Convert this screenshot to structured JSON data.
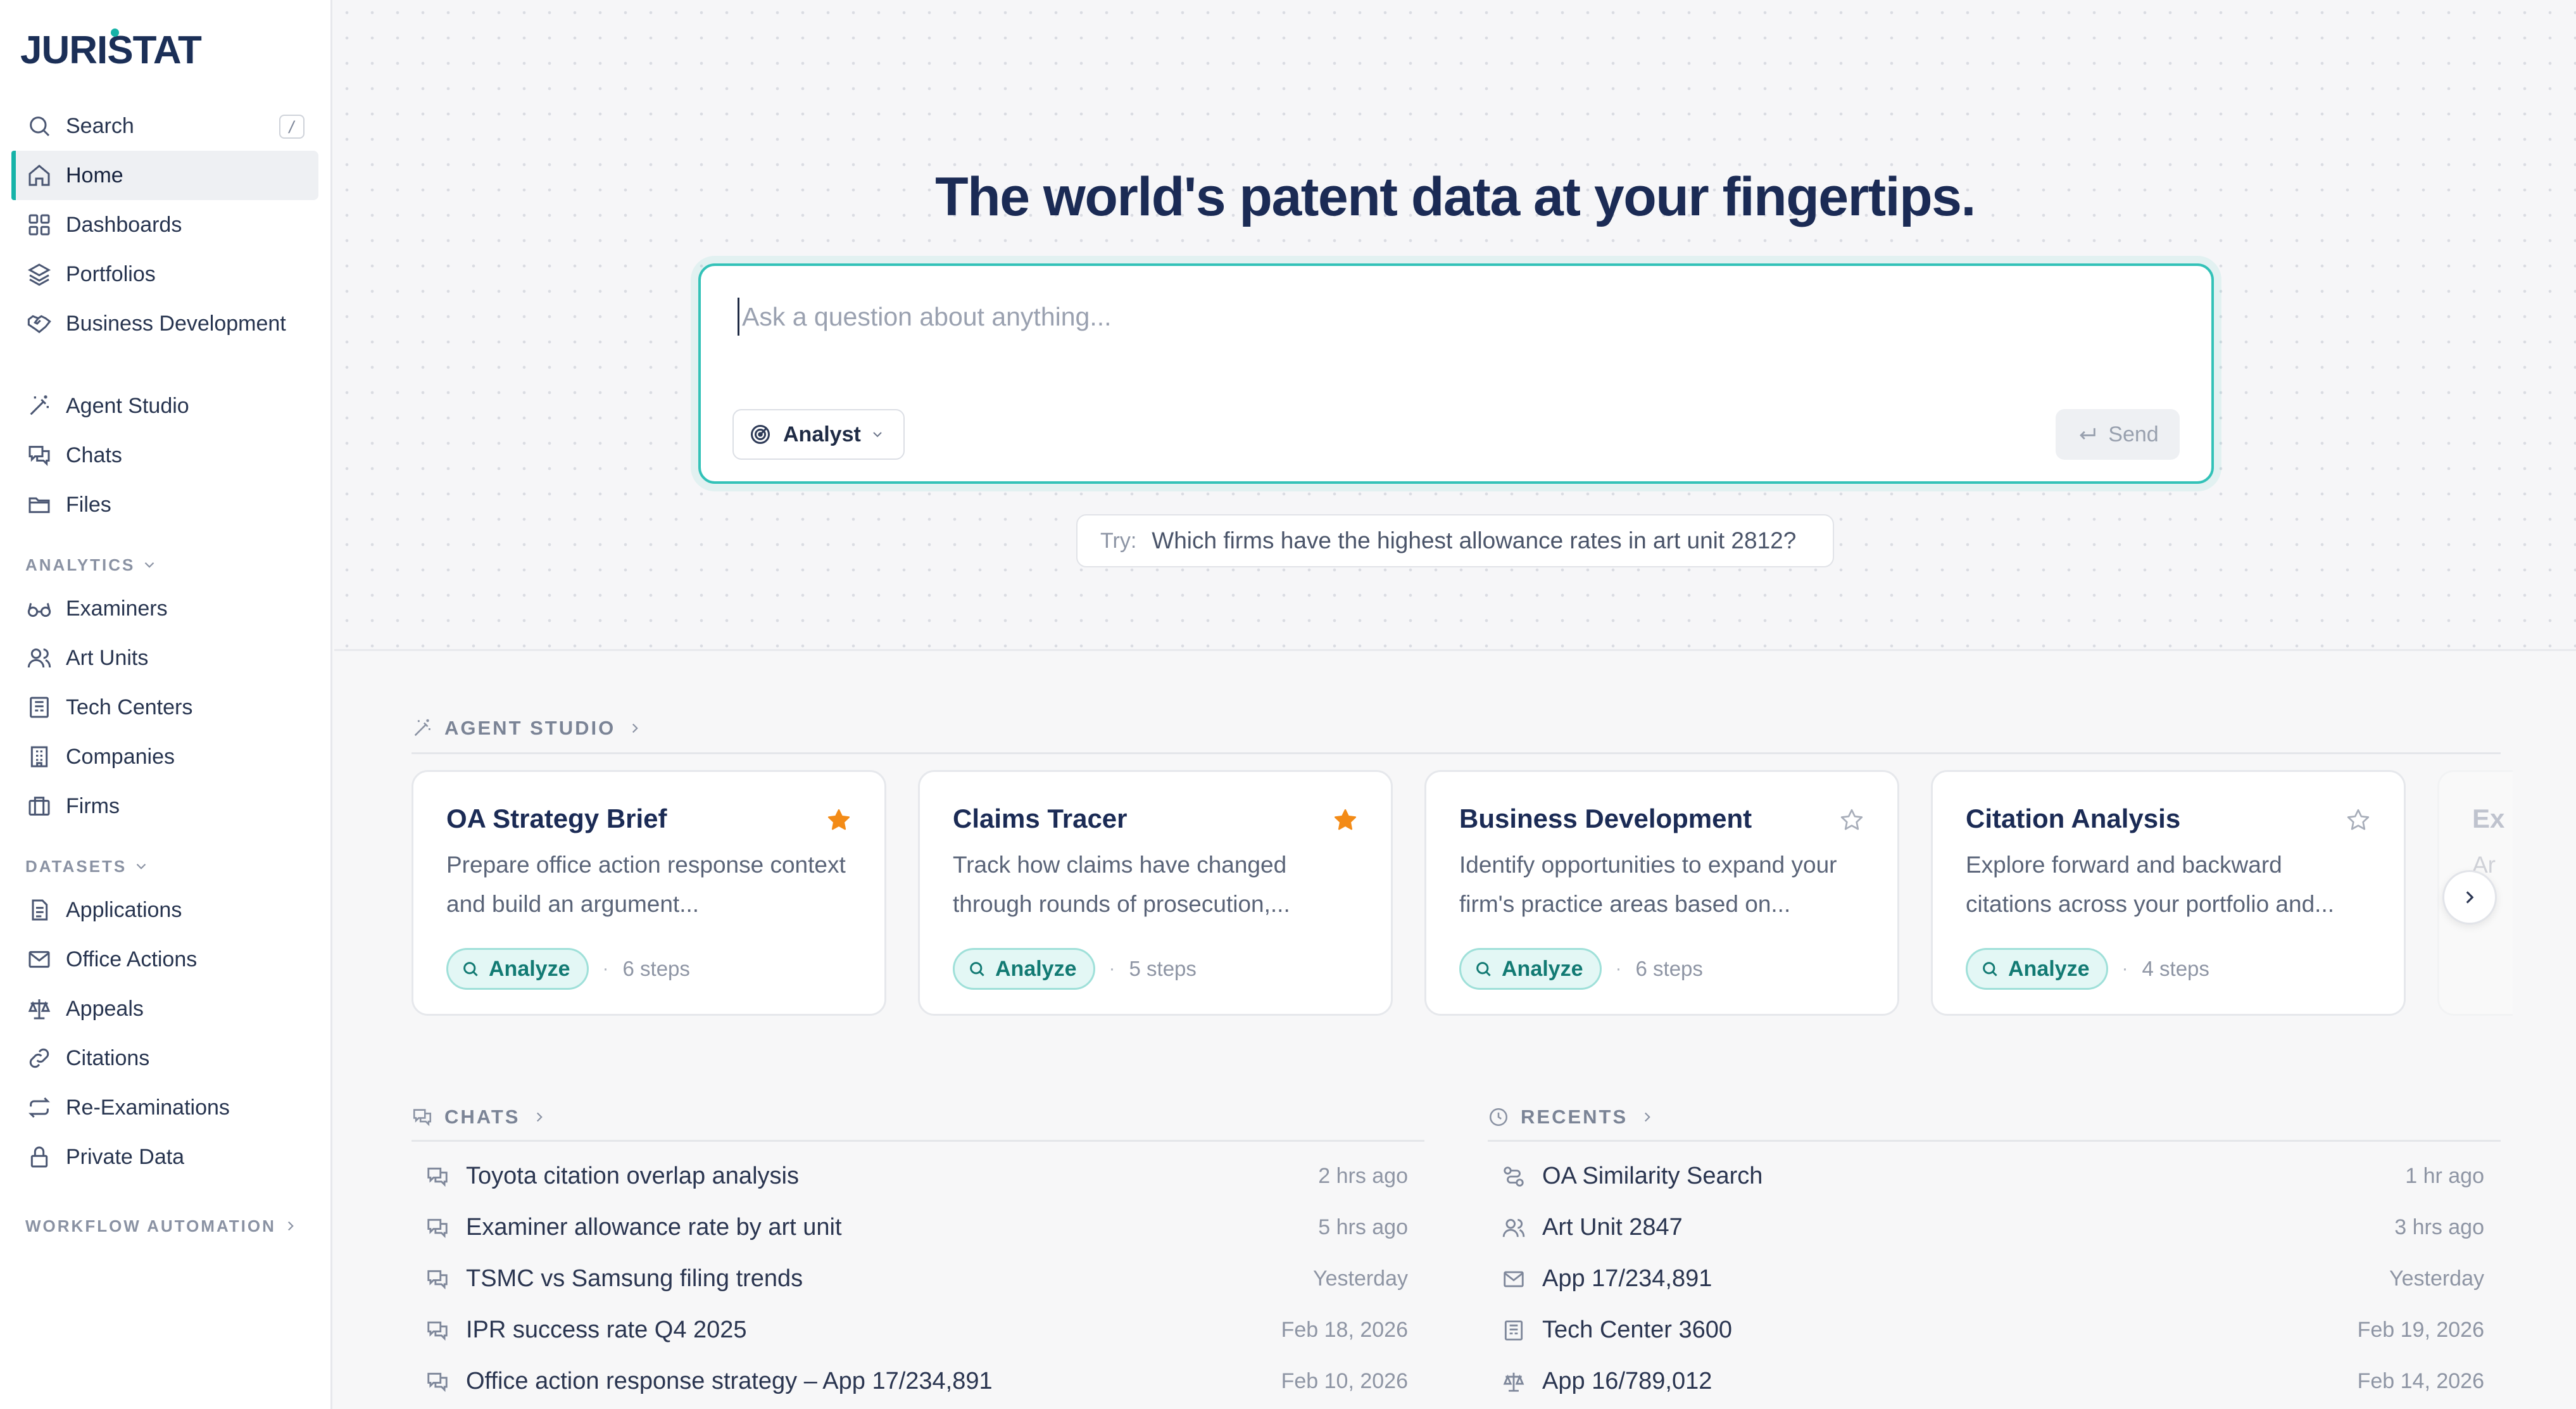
{
  "brand": {
    "name": "JURISTAT",
    "accent": "#16b3a8",
    "navy": "#1b2b55"
  },
  "sidebar": {
    "search": {
      "label": "Search",
      "shortcut": "/"
    },
    "primary": [
      {
        "label": "Home",
        "icon": "home-icon",
        "active": true
      },
      {
        "label": "Dashboards",
        "icon": "grid-icon"
      },
      {
        "label": "Portfolios",
        "icon": "layers-icon"
      },
      {
        "label": "Business Development",
        "icon": "handshake-icon"
      }
    ],
    "workspace": [
      {
        "label": "Agent Studio",
        "icon": "magic-wand-icon"
      },
      {
        "label": "Chats",
        "icon": "chat-icon"
      },
      {
        "label": "Files",
        "icon": "folder-icon"
      }
    ],
    "analytics": {
      "label": "ANALYTICS",
      "items": [
        {
          "label": "Examiners",
          "icon": "glasses-icon"
        },
        {
          "label": "Art Units",
          "icon": "users-icon"
        },
        {
          "label": "Tech Centers",
          "icon": "building-panel-icon"
        },
        {
          "label": "Companies",
          "icon": "office-building-icon"
        },
        {
          "label": "Firms",
          "icon": "briefcase-icon"
        }
      ]
    },
    "datasets": {
      "label": "DATASETS",
      "items": [
        {
          "label": "Applications",
          "icon": "document-icon"
        },
        {
          "label": "Office Actions",
          "icon": "mail-icon"
        },
        {
          "label": "Appeals",
          "icon": "scale-icon"
        },
        {
          "label": "Citations",
          "icon": "link-icon"
        },
        {
          "label": "Re-Examinations",
          "icon": "repeat-icon"
        },
        {
          "label": "Private Data",
          "icon": "lock-icon"
        }
      ]
    },
    "workflow": {
      "label": "WORKFLOW AUTOMATION"
    }
  },
  "hero": {
    "title": "The world's patent data at your fingertips.",
    "input_placeholder": "Ask a question about anything...",
    "mode": "Analyst",
    "send_label": "Send",
    "try_prefix": "Try:",
    "try_text": "Which firms have the highest allowance rates in art unit 2812?"
  },
  "agent_studio": {
    "label": "AGENT STUDIO",
    "cards": [
      {
        "title": "OA Strategy Brief",
        "desc": "Prepare office action response context and build an argument...",
        "starred": true,
        "action": "Analyze",
        "steps": "6 steps"
      },
      {
        "title": "Claims Tracer",
        "desc": "Track how claims have changed through rounds of prosecution,...",
        "starred": true,
        "action": "Analyze",
        "steps": "5 steps"
      },
      {
        "title": "Business Development",
        "desc": "Identify opportunities to expand your firm's practice areas based on...",
        "starred": false,
        "action": "Analyze",
        "steps": "6 steps"
      },
      {
        "title": "Citation Analysis",
        "desc": "Explore forward and backward citations across your portfolio and...",
        "starred": false,
        "action": "Analyze",
        "steps": "4 steps"
      },
      {
        "title": "Ex",
        "desc": "Ar",
        "starred": false,
        "action": "",
        "steps": ""
      }
    ]
  },
  "chats": {
    "label": "CHATS",
    "items": [
      {
        "title": "Toyota citation overlap analysis",
        "time": "2 hrs ago"
      },
      {
        "title": "Examiner allowance rate by art unit",
        "time": "5 hrs ago"
      },
      {
        "title": "TSMC vs Samsung filing trends",
        "time": "Yesterday"
      },
      {
        "title": "IPR success rate Q4 2025",
        "time": "Feb 18, 2026"
      },
      {
        "title": "Office action response strategy – App 17/234,891",
        "time": "Feb 10, 2026"
      }
    ]
  },
  "recents": {
    "label": "RECENTS",
    "items": [
      {
        "title": "OA Similarity Search",
        "time": "1 hr ago",
        "icon": "route-icon"
      },
      {
        "title": "Art Unit 2847",
        "time": "3 hrs ago",
        "icon": "users-icon"
      },
      {
        "title": "App 17/234,891",
        "time": "Yesterday",
        "icon": "mail-icon"
      },
      {
        "title": "Tech Center 3600",
        "time": "Feb 19, 2026",
        "icon": "building-panel-icon"
      },
      {
        "title": "App 16/789,012",
        "time": "Feb 14, 2026",
        "icon": "scale-icon"
      }
    ]
  }
}
